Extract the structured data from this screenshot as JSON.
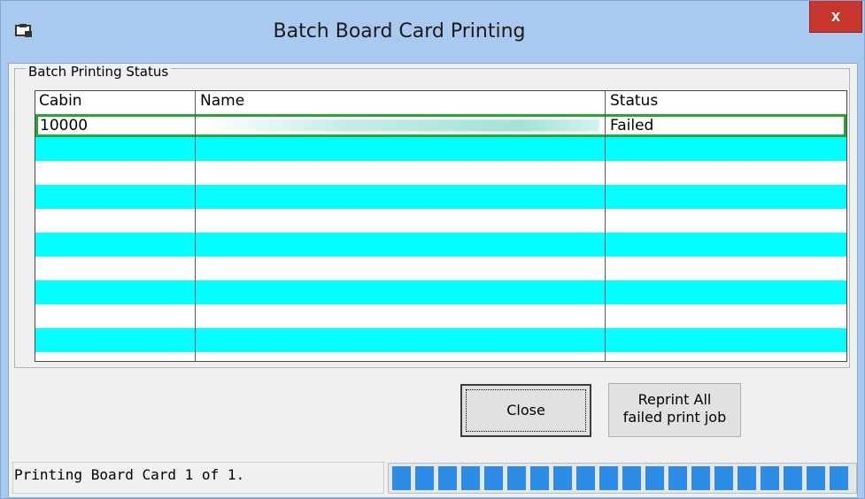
{
  "window": {
    "title": "Batch Board Card Printing",
    "close_glyph": "x",
    "app_icon": "printer-card-icon"
  },
  "group": {
    "label": "Batch Printing Status"
  },
  "grid": {
    "columns": [
      "Cabin",
      "Name",
      "Status"
    ],
    "rows": [
      {
        "cabin": "10000",
        "name": "[redacted]",
        "status": "Failed",
        "selected": true
      }
    ],
    "stripe_colors": {
      "odd": "#00ffff",
      "even": "#ffffff"
    },
    "selection_color": "#2aa535"
  },
  "buttons": {
    "close": "Close",
    "reprint_line1": "Reprint All",
    "reprint_line2": "failed print job"
  },
  "status": {
    "text": "Printing Board Card 1 of 1.",
    "progress_fraction": 1.0,
    "progress_color": "#2b8de6"
  }
}
